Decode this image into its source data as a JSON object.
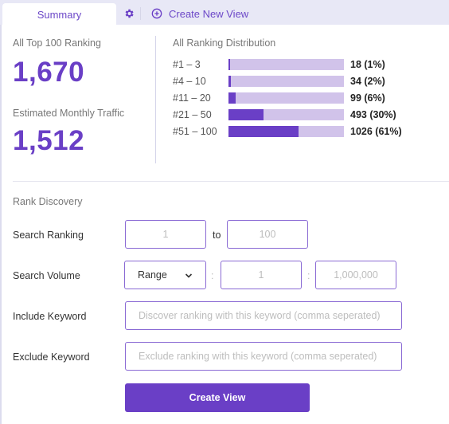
{
  "tabs": {
    "summary_label": "Summary",
    "settings_icon": "gear-icon",
    "create_view_label": "Create New View",
    "create_view_icon": "plus-circle-icon"
  },
  "stats": {
    "top100_label": "All Top 100 Ranking",
    "top100_value": "1,670",
    "traffic_label": "Estimated Monthly Traffic",
    "traffic_value": "1,512"
  },
  "distribution": {
    "title": "All Ranking Distribution",
    "rows": [
      {
        "label": "#1 – 3",
        "count": 18,
        "percent": 1,
        "value_text": "18 (1%)"
      },
      {
        "label": "#4 – 10",
        "count": 34,
        "percent": 2,
        "value_text": "34 (2%)"
      },
      {
        "label": "#11 – 20",
        "count": 99,
        "percent": 6,
        "value_text": "99 (6%)"
      },
      {
        "label": "#21 – 50",
        "count": 493,
        "percent": 30,
        "value_text": "493 (30%)"
      },
      {
        "label": "#51 – 100",
        "count": 1026,
        "percent": 61,
        "value_text": "1026 (61%)"
      }
    ]
  },
  "rank_discovery": {
    "title": "Rank Discovery",
    "search_ranking": {
      "label": "Search Ranking",
      "from_placeholder": "1",
      "to_label": "to",
      "to_placeholder": "100"
    },
    "search_volume": {
      "label": "Search Volume",
      "mode": "Range",
      "separator": ":",
      "min_placeholder": "1",
      "max_placeholder": "1,000,000"
    },
    "include_keyword": {
      "label": "Include Keyword",
      "placeholder": "Discover ranking with this keyword (comma seperated)"
    },
    "exclude_keyword": {
      "label": "Exclude Keyword",
      "placeholder": "Exclude ranking with this keyword (comma seperated)"
    },
    "submit_label": "Create View"
  },
  "colors": {
    "accent": "#6a3fc6",
    "bar_track": "#d1c3ea",
    "tabbar_bg": "#e8e8f6"
  }
}
